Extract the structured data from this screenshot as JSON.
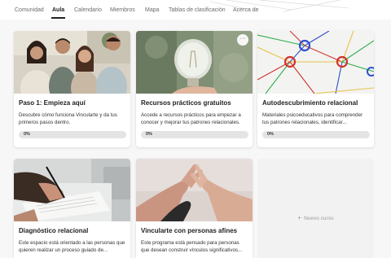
{
  "nav": {
    "tabs": [
      {
        "label": "Comunidad",
        "active": false
      },
      {
        "label": "Aula",
        "active": true
      },
      {
        "label": "Calendario",
        "active": false
      },
      {
        "label": "Miembros",
        "active": false
      },
      {
        "label": "Mapa",
        "active": false
      },
      {
        "label": "Tablas de clasificación",
        "active": false
      },
      {
        "label": "Acerca de",
        "active": false
      }
    ]
  },
  "courses": [
    {
      "title": "Paso 1: Empieza aquí",
      "description": "Descubre cómo funciona Vincularte y da tus primeros pasos dentro.",
      "progress_label": "0%",
      "progress": 0,
      "image": "group-of-people-photo"
    },
    {
      "title": "Recursos prácticos gratuitos",
      "description": "Accede a recursos prácticos para empezar a conocer y mejorar tus patrones relacionales.",
      "progress_label": "0%",
      "progress": 0,
      "image": "lightbulb-in-hand-photo",
      "more_label": "···"
    },
    {
      "title": "Autodescubrimiento relacional",
      "description": "Materiales psicoeducativos para comprender tus patrones relacionales, identificar...",
      "progress_label": "0%",
      "progress": 0,
      "image": "network-nodes-illustration"
    },
    {
      "title": "Diagnóstico relacional",
      "description": "Este espacio está orientado a las personas que quieren realizar un proceso guiado de...",
      "image": "hand-writing-form-photo"
    },
    {
      "title": "Vincularte con personas afines",
      "description": "Este programa está pensado para personas que desean construir vínculos significativos...",
      "image": "hands-reaching-photo"
    }
  ],
  "new_course": {
    "label": "Nuevo curso",
    "icon": "plus-icon"
  },
  "colors": {
    "accent": "#222222",
    "progress_track": "#e4e4e4",
    "muted_text": "#6b6b6b"
  }
}
